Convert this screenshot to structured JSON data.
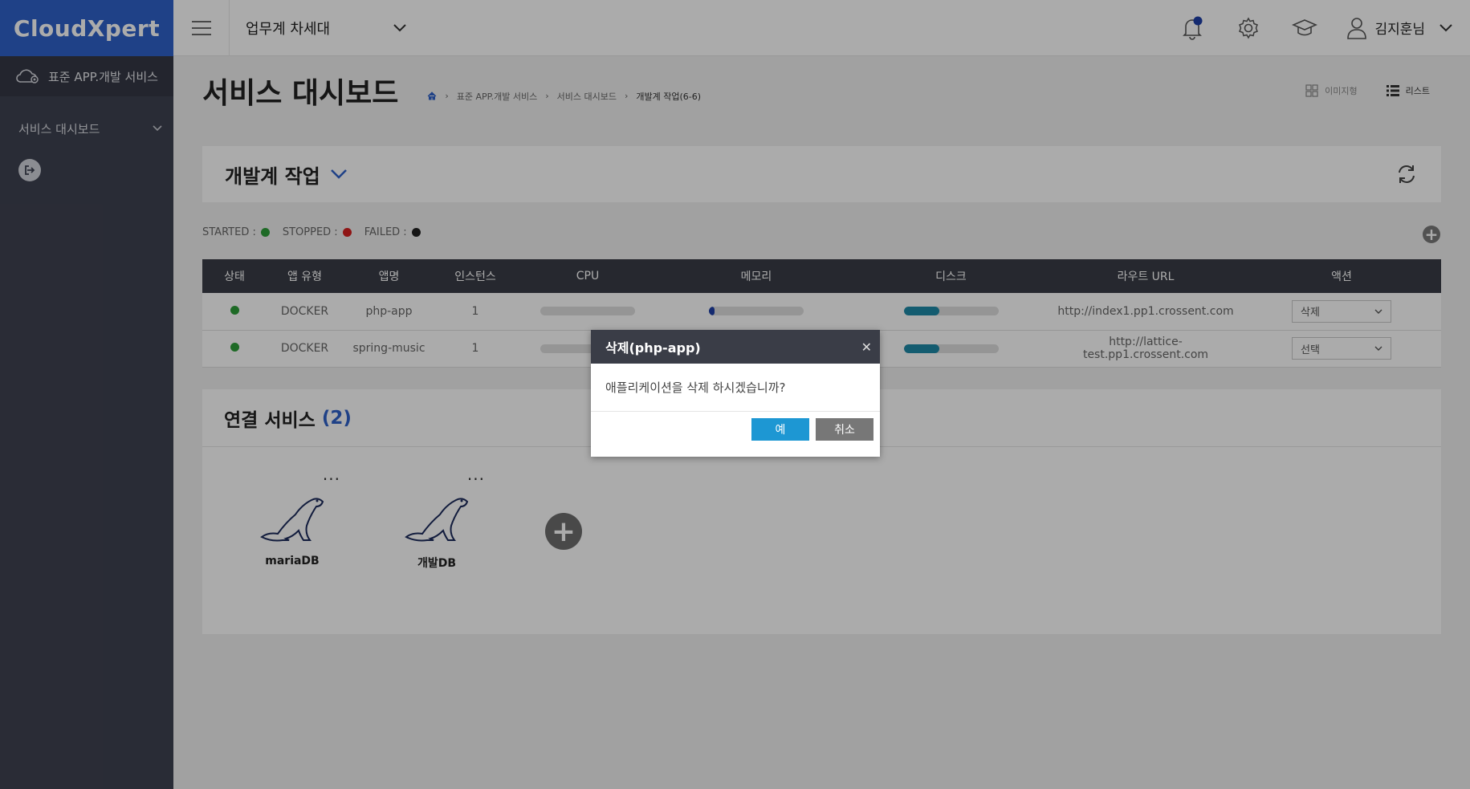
{
  "app": {
    "logo": "CloudXpert"
  },
  "sidebar": {
    "service": "표준 APP.개발 서비스",
    "menu_item": "서비스 대시보드"
  },
  "header": {
    "workspace": "업무계 차세대",
    "user": "김지훈님"
  },
  "page": {
    "title": "서비스 대시보드",
    "breadcrumb": [
      "표준 APP.개발 서비스",
      "서비스 대시보드",
      "개발계 작업(6-6)"
    ],
    "view_image": "이미지형",
    "view_list": "리스트"
  },
  "section": {
    "title": "개발계 작업",
    "legend": {
      "started": "STARTED :",
      "stopped": "STOPPED :",
      "failed": "FAILED :"
    }
  },
  "table": {
    "headers": [
      "상태",
      "앱 유형",
      "앱명",
      "인스턴스",
      "CPU",
      "메모리",
      "디스크",
      "라우트 URL",
      "액션"
    ],
    "rows": [
      {
        "type": "DOCKER",
        "name": "php-app",
        "instances": "1",
        "cpu": 0,
        "memory": 0.06,
        "disk": 0.38,
        "url": "http://index1.pp1.crossent.com",
        "action": "삭제"
      },
      {
        "type": "DOCKER",
        "name": "spring-music",
        "instances": "1",
        "cpu": 0,
        "memory": 0,
        "disk": 0.38,
        "url": "http://lattice-test.pp1.crossent.com",
        "action": "선택"
      }
    ]
  },
  "services": {
    "title": "연결 서비스",
    "count": "(2)",
    "items": [
      {
        "name": "mariaDB",
        "menu": "..."
      },
      {
        "name": "개발DB",
        "menu": "..."
      }
    ]
  },
  "modal": {
    "title": "삭제(php-app)",
    "message": "애플리케이션을 삭제 하시겠습니까?",
    "ok": "예",
    "cancel": "취소"
  },
  "colors": {
    "started": "#2e9e3a",
    "stopped": "#d62020",
    "failed": "#222222",
    "memory_fill": "#1f3fa8",
    "disk_fill": "#1e8aa8",
    "accent": "#2f62c9"
  }
}
